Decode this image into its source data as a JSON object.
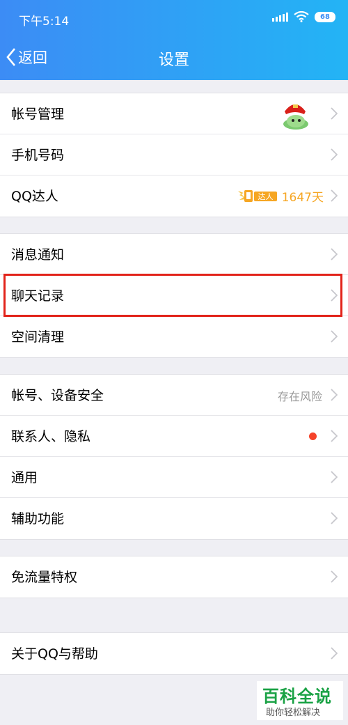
{
  "status": {
    "time": "下午5:14",
    "battery": "68"
  },
  "nav": {
    "back_label": "返回",
    "title": "设置"
  },
  "groups": [
    {
      "items": [
        {
          "label": "帐号管理",
          "has_avatar": true
        },
        {
          "label": "手机号码"
        },
        {
          "label": "QQ达人",
          "badge_text": "达人",
          "value": "1647天"
        }
      ]
    },
    {
      "items": [
        {
          "label": "消息通知"
        },
        {
          "label": "聊天记录",
          "highlighted": true
        },
        {
          "label": "空间清理"
        }
      ]
    },
    {
      "items": [
        {
          "label": "帐号、设备安全",
          "value": "存在风险"
        },
        {
          "label": "联系人、隐私",
          "red_dot": true
        },
        {
          "label": "通用"
        },
        {
          "label": "辅助功能"
        }
      ]
    },
    {
      "items": [
        {
          "label": "免流量特权"
        }
      ]
    },
    {
      "items": [
        {
          "label": "关于QQ与帮助"
        }
      ]
    }
  ],
  "colors": {
    "header_start": "#3c8cf5",
    "header_end": "#23b4f5",
    "accent_orange": "#f6a623",
    "highlight_red": "#e2231a",
    "dot_red": "#f5432a"
  },
  "watermark": {
    "title": "百科全说",
    "subtitle": "助你轻松解决"
  }
}
